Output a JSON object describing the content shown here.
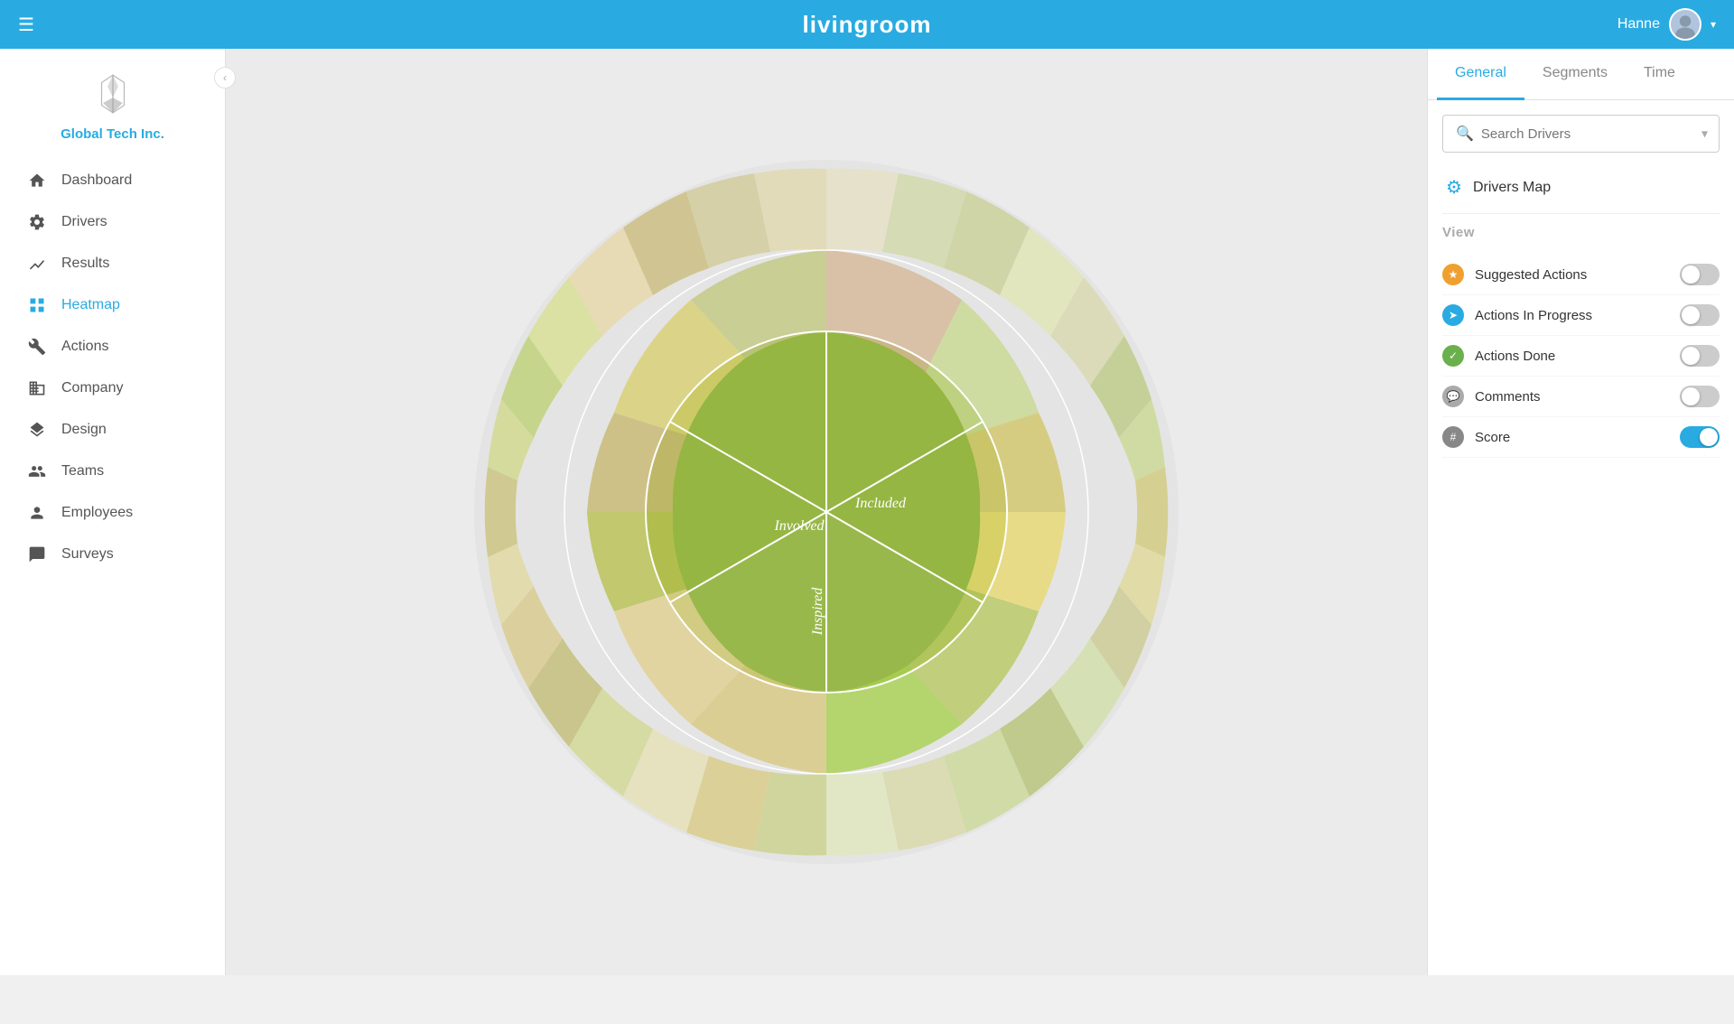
{
  "topbar": {
    "menu_icon": "☰",
    "title": "livingroom",
    "user_name": "Hanne",
    "chevron": "▾"
  },
  "sidebar": {
    "collapse_icon": "‹",
    "company_name": "Global Tech Inc.",
    "nav_items": [
      {
        "id": "dashboard",
        "label": "Dashboard",
        "icon": "home"
      },
      {
        "id": "drivers",
        "label": "Drivers",
        "icon": "gear"
      },
      {
        "id": "results",
        "label": "Results",
        "icon": "chart"
      },
      {
        "id": "heatmap",
        "label": "Heatmap",
        "icon": "grid",
        "active": true
      },
      {
        "id": "actions",
        "label": "Actions",
        "icon": "wrench"
      },
      {
        "id": "company",
        "label": "Company",
        "icon": "building"
      },
      {
        "id": "design",
        "label": "Design",
        "icon": "layers"
      },
      {
        "id": "teams",
        "label": "Teams",
        "icon": "people"
      },
      {
        "id": "employees",
        "label": "Employees",
        "icon": "person"
      },
      {
        "id": "surveys",
        "label": "Surveys",
        "icon": "chat"
      }
    ]
  },
  "right_panel": {
    "tabs": [
      {
        "id": "general",
        "label": "General",
        "active": true
      },
      {
        "id": "segments",
        "label": "Segments"
      },
      {
        "id": "time",
        "label": "Time"
      }
    ],
    "search_placeholder": "Search Drivers",
    "drivers_map_label": "Drivers Map",
    "view_label": "View",
    "toggles": [
      {
        "id": "suggested-actions",
        "label": "Suggested Actions",
        "icon_type": "orange",
        "icon_char": "★",
        "on": false
      },
      {
        "id": "actions-in-progress",
        "label": "Actions In Progress",
        "icon_type": "blue",
        "icon_char": "➤",
        "on": false
      },
      {
        "id": "actions-done",
        "label": "Actions Done",
        "icon_type": "green",
        "icon_char": "✓",
        "on": false
      },
      {
        "id": "comments",
        "label": "Comments",
        "icon_type": "gray",
        "icon_char": "💬",
        "on": false
      },
      {
        "id": "score",
        "label": "Score",
        "icon_type": "hash",
        "icon_char": "#",
        "on": true
      }
    ]
  },
  "chart": {
    "center_labels": [
      "Involved",
      "Included",
      "Inspired"
    ]
  }
}
